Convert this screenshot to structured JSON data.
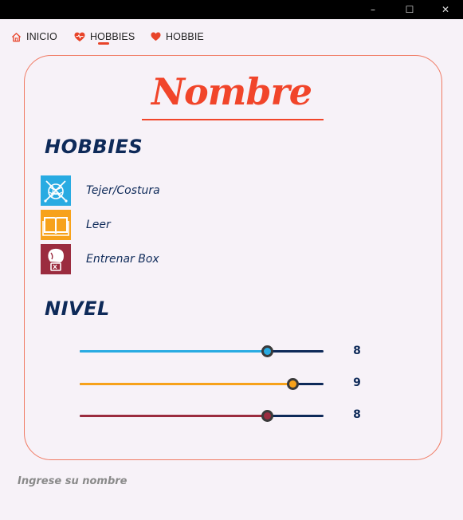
{
  "window": {
    "minimize_glyph": "–",
    "maximize_glyph": "☐",
    "close_glyph": "✕"
  },
  "nav": {
    "items": [
      {
        "label": "INICIO",
        "icon": "home-icon"
      },
      {
        "label": "HOBBIES",
        "icon": "heart-pulse-icon",
        "active": true
      },
      {
        "label": "HOBBIE",
        "icon": "heart-icon"
      }
    ],
    "accent": "#e8442a"
  },
  "card": {
    "title": "Nombre",
    "hobbies_heading": "HOBBIES",
    "hobbies": [
      {
        "label": "Tejer/Costura",
        "icon": "yarn-needles-icon",
        "color": "#29abe2"
      },
      {
        "label": "Leer",
        "icon": "open-book-icon",
        "color": "#f7a21b"
      },
      {
        "label": "Entrenar Box",
        "icon": "boxing-glove-icon",
        "color": "#9b2c3f"
      }
    ],
    "level_heading": "NIVEL",
    "levels": [
      {
        "value": "8",
        "fraction": 0.768,
        "color": "#29abe2"
      },
      {
        "value": "9",
        "fraction": 0.873,
        "color": "#f7a21b"
      },
      {
        "value": "8",
        "fraction": 0.768,
        "color": "#9b2c3f"
      }
    ]
  },
  "name_input": {
    "placeholder": "Ingrese su nombre",
    "value": ""
  },
  "colors": {
    "title": "#f1452a",
    "heading": "#0e2a59",
    "card_border": "#f07a63",
    "background": "#f7f2f8"
  }
}
